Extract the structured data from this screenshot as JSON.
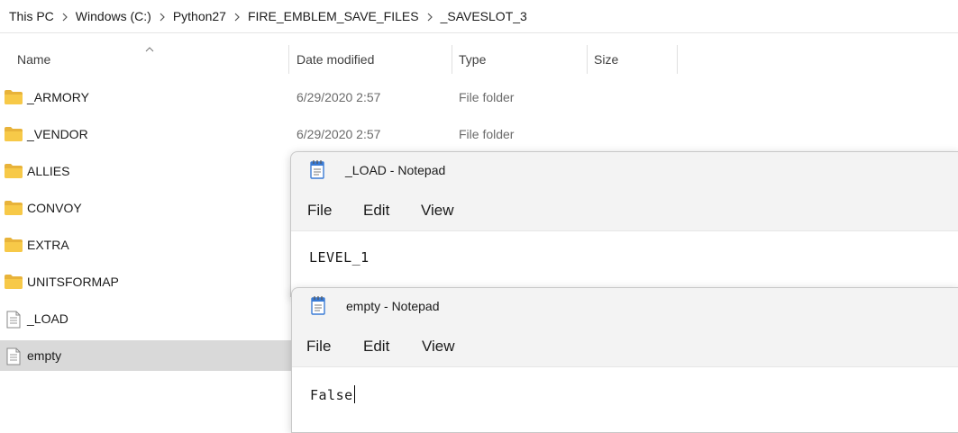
{
  "breadcrumb": {
    "items": [
      "This PC",
      "Windows (C:)",
      "Python27",
      "FIRE_EMBLEM_SAVE_FILES",
      "_SAVESLOT_3"
    ]
  },
  "columns": {
    "name": "Name",
    "date_modified": "Date modified",
    "type": "Type",
    "size": "Size"
  },
  "files": [
    {
      "name": "_ARMORY",
      "date": "6/29/2020 2:57",
      "type": "File folder",
      "icon": "folder-icon"
    },
    {
      "name": "_VENDOR",
      "date": "6/29/2020 2:57",
      "type": "File folder",
      "icon": "folder-icon"
    },
    {
      "name": "ALLIES",
      "icon": "folder-icon"
    },
    {
      "name": "CONVOY",
      "icon": "folder-icon"
    },
    {
      "name": "EXTRA",
      "icon": "folder-icon"
    },
    {
      "name": "UNITSFORMAP",
      "icon": "folder-icon"
    },
    {
      "name": "_LOAD",
      "icon": "text-file-icon"
    },
    {
      "name": "empty",
      "icon": "text-file-icon",
      "selected": true
    }
  ],
  "notepad_load": {
    "title": "_LOAD - Notepad",
    "menu": {
      "file": "File",
      "edit": "Edit",
      "view": "View"
    },
    "content": "LEVEL_1"
  },
  "notepad_empty": {
    "title": "empty - Notepad",
    "menu": {
      "file": "File",
      "edit": "Edit",
      "view": "View"
    },
    "content": "False"
  },
  "colors": {
    "folder": "#f7c948",
    "selection": "#d9d9d9",
    "notepad_chrome": "#f3f3f3",
    "notepad_icon": "#3a7bd5"
  }
}
